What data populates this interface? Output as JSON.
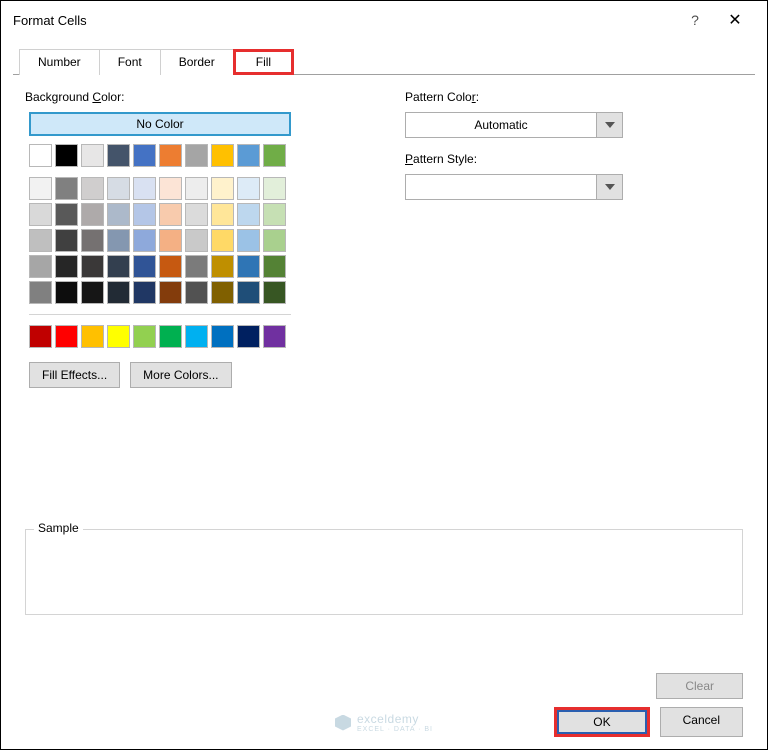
{
  "titlebar": {
    "title": "Format Cells",
    "help": "?",
    "close": "✕"
  },
  "tabs": [
    {
      "label": "Number"
    },
    {
      "label": "Font"
    },
    {
      "label": "Border"
    },
    {
      "label": "Fill",
      "active": true,
      "highlight": true
    }
  ],
  "left": {
    "bg_label_pre": "Background ",
    "bg_label_ul": "C",
    "bg_label_post": "olor:",
    "no_color": "No Color",
    "row1": [
      "#ffffff",
      "#000000",
      "#e7e6e6",
      "#44546a",
      "#4472c4",
      "#ed7d31",
      "#a5a5a5",
      "#ffc000",
      "#5b9bd5",
      "#70ad47"
    ],
    "theme_rows": [
      [
        "#f2f2f2",
        "#808080",
        "#d0cece",
        "#d6dce4",
        "#d9e1f2",
        "#fce4d6",
        "#ededed",
        "#fff2cc",
        "#ddebf7",
        "#e2efda"
      ],
      [
        "#d9d9d9",
        "#595959",
        "#aeaaaa",
        "#acb9ca",
        "#b4c6e7",
        "#f8cbad",
        "#dbdbdb",
        "#ffe699",
        "#bdd7ee",
        "#c6e0b4"
      ],
      [
        "#bfbfbf",
        "#404040",
        "#757171",
        "#8497b0",
        "#8ea9db",
        "#f4b084",
        "#c9c9c9",
        "#ffd966",
        "#9bc2e6",
        "#a9d08e"
      ],
      [
        "#a6a6a6",
        "#262626",
        "#3a3838",
        "#333f4f",
        "#305496",
        "#c65911",
        "#7b7b7b",
        "#bf8f00",
        "#2f75b5",
        "#548235"
      ],
      [
        "#808080",
        "#0d0d0d",
        "#161616",
        "#222b35",
        "#203764",
        "#833c0c",
        "#525252",
        "#806000",
        "#1f4e78",
        "#375623"
      ]
    ],
    "standard": [
      "#c00000",
      "#ff0000",
      "#ffc000",
      "#ffff00",
      "#92d050",
      "#00b050",
      "#00b0f0",
      "#0070c0",
      "#002060",
      "#7030a0"
    ],
    "fill_effects_pre": "F",
    "fill_effects_ul": "i",
    "fill_effects_post": "ll Effects...",
    "more_colors_ul": "M",
    "more_colors_post": "ore Colors..."
  },
  "right": {
    "pc_label_pre": "Pattern Colo",
    "pc_label_ul": "r",
    "pc_label_post": ":",
    "automatic": "Automatic",
    "ps_label_ul": "P",
    "ps_label_post": "attern Style:",
    "ps_value": ""
  },
  "sample": {
    "label": "Sample"
  },
  "buttons": {
    "clear": "Clear",
    "ok": "OK",
    "cancel": "Cancel"
  },
  "watermark": {
    "brand": "exceldemy",
    "tagline": "EXCEL · DATA · BI"
  }
}
